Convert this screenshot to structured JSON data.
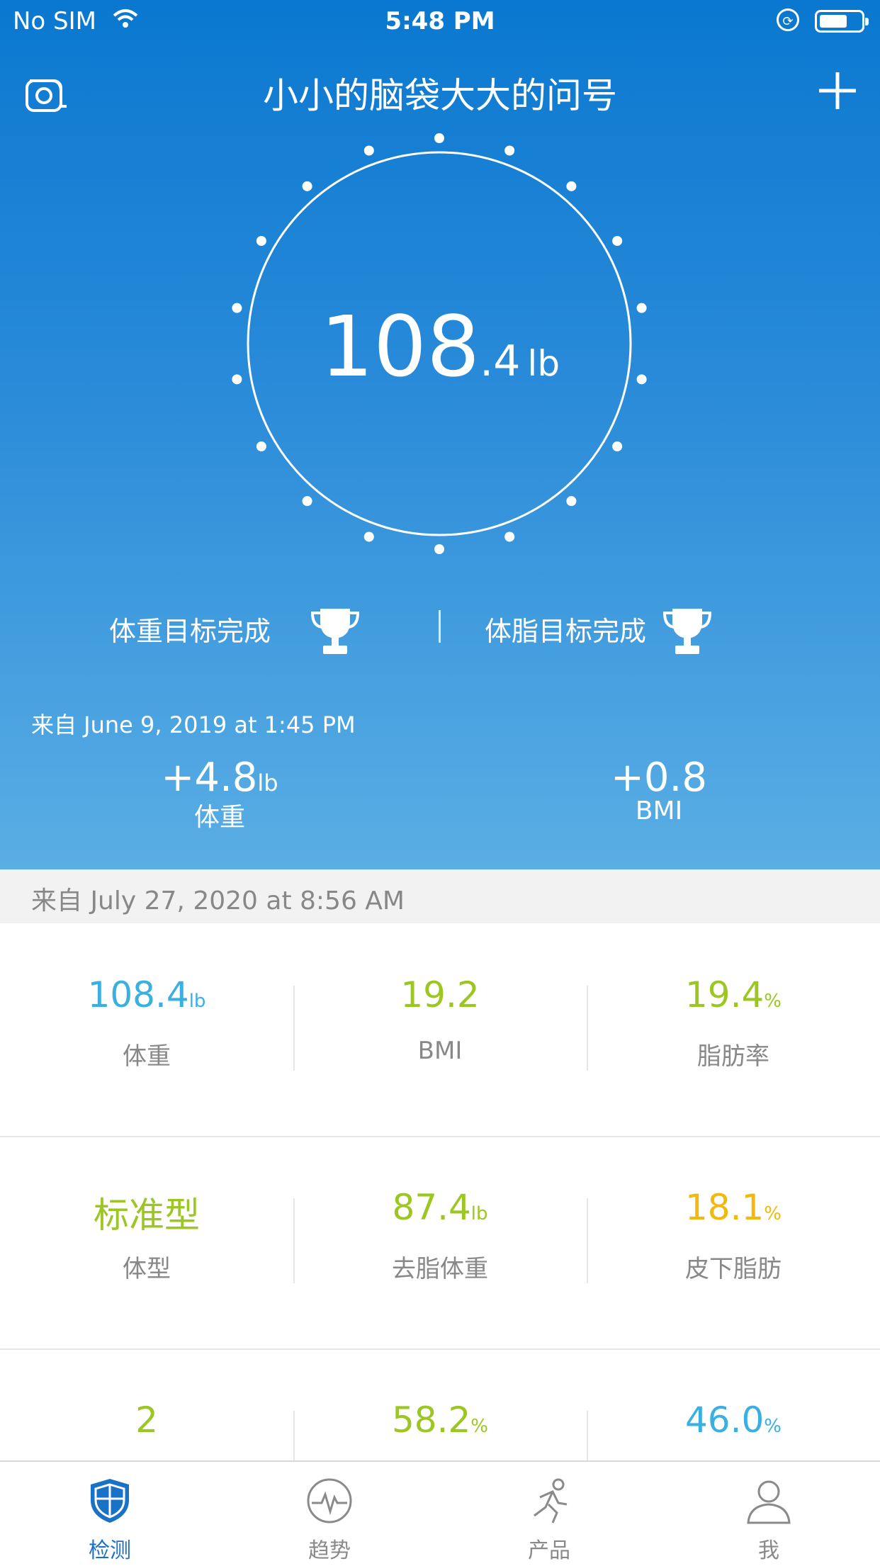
{
  "status_bar": {
    "carrier": "No SIM",
    "time": "5:48 PM"
  },
  "header": {
    "title": "小小的脑袋大大的问号"
  },
  "current": {
    "weight_int": "108",
    "weight_dec": ".4",
    "weight_unit": "lb"
  },
  "goals": {
    "weight_goal": "体重目标完成",
    "fat_goal": "体脂目标完成"
  },
  "comparison": {
    "from": "来自 June 9, 2019 at 1:45 PM",
    "weight_delta": "+4.8",
    "weight_unit": "lb",
    "weight_label": "体重",
    "bmi_delta": "+0.8",
    "bmi_label": "BMI"
  },
  "measurement": {
    "from": "来自 July 27, 2020 at 8:56 AM",
    "rows": [
      [
        {
          "value": "108.4",
          "unit": "lb",
          "label": "体重",
          "color": "#3ab0e2"
        },
        {
          "value": "19.2",
          "unit": "",
          "label": "BMI",
          "color": "#9cc622"
        },
        {
          "value": "19.4",
          "unit": "%",
          "label": "脂肪率",
          "color": "#9cc622"
        }
      ],
      [
        {
          "value": "标准型",
          "unit": "",
          "label": "体型",
          "color": "#9cc622"
        },
        {
          "value": "87.4",
          "unit": "lb",
          "label": "去脂体重",
          "color": "#9cc622"
        },
        {
          "value": "18.1",
          "unit": "%",
          "label": "皮下脂肪",
          "color": "#f2b90c"
        }
      ],
      [
        {
          "value": "2",
          "unit": "",
          "label": "",
          "color": "#9cc622"
        },
        {
          "value": "58.2",
          "unit": "%",
          "label": "",
          "color": "#9cc622"
        },
        {
          "value": "46.0",
          "unit": "%",
          "label": "",
          "color": "#3ab0e2"
        }
      ]
    ]
  },
  "tabs": [
    {
      "label": "检测",
      "icon": "shield-icon",
      "active": true
    },
    {
      "label": "趋势",
      "icon": "pulse-icon",
      "active": false
    },
    {
      "label": "产品",
      "icon": "person-running-icon",
      "active": false
    },
    {
      "label": "我",
      "icon": "user-icon",
      "active": false
    }
  ],
  "colors": {
    "header_top": "#0a78d0",
    "header_bottom": "#5aaee4",
    "active_tab": "#1a72c6"
  }
}
